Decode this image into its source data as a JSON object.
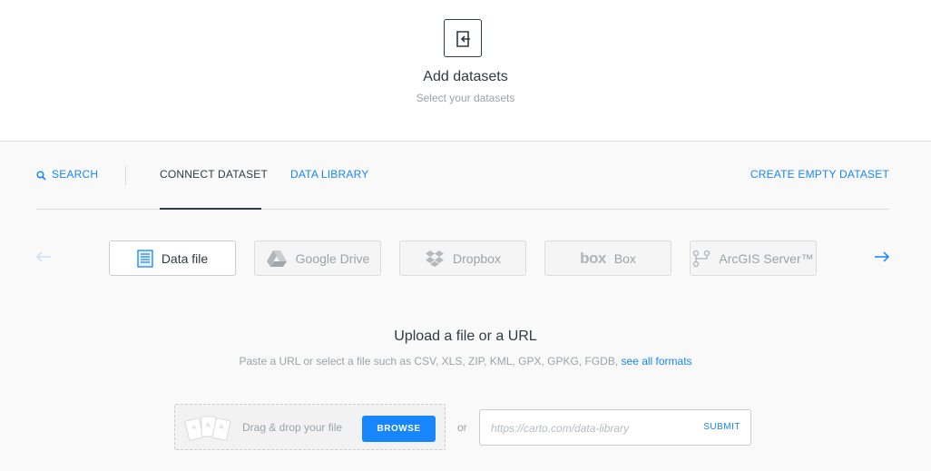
{
  "header": {
    "icon": "import-arrow-icon",
    "title": "Add datasets",
    "subtitle": "Select your datasets"
  },
  "tabs": {
    "search": "SEARCH",
    "connect": "CONNECT DATASET",
    "library": "DATA LIBRARY",
    "create_empty": "CREATE EMPTY DATASET"
  },
  "connectors": [
    {
      "label": "Data file",
      "icon": "document-icon",
      "active": true
    },
    {
      "label": "Google Drive",
      "icon": "google-drive-icon",
      "active": false
    },
    {
      "label": "Dropbox",
      "icon": "dropbox-icon",
      "active": false
    },
    {
      "label": "Box",
      "icon": "box-logo-icon",
      "logo_text": "box",
      "active": false
    },
    {
      "label": "ArcGIS Server™",
      "icon": "arcgis-icon",
      "active": false
    }
  ],
  "upload": {
    "title": "Upload a file or a URL",
    "description": "Paste a URL or select a file such as CSV, XLS, ZIP, KML, GPX, GPKG, FGDB,",
    "formats_link": "see all formats",
    "drag_text": "Drag & drop your file",
    "browse_label": "BROWSE",
    "or_text": "or",
    "url_placeholder": "https://carto.com/data-library",
    "url_value": "",
    "submit_label": "SUBMIT"
  },
  "colors": {
    "accent": "#1785fb",
    "text": "#2e3c43",
    "muted": "#9aa3a7",
    "border": "#dddddd"
  }
}
